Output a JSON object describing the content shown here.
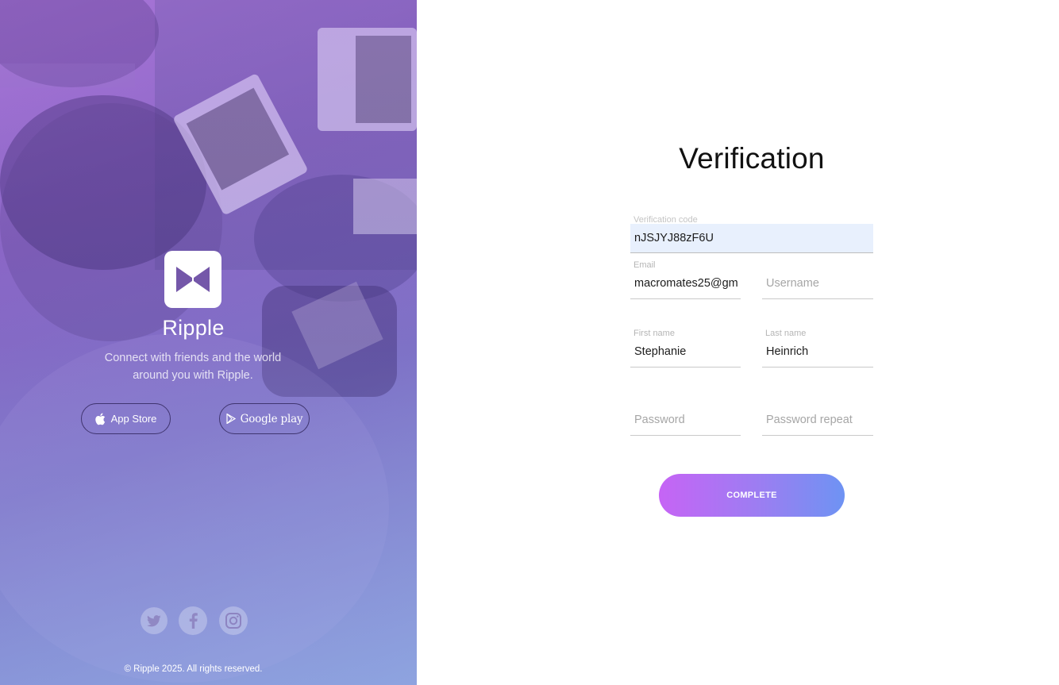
{
  "hero": {
    "brand_name": "Ripple",
    "tagline": "Connect with friends and the world around you with Ripple.",
    "app_store_label": "App Store",
    "google_play_label": "Google play",
    "social_icons": [
      "twitter-icon",
      "facebook-icon",
      "instagram-icon"
    ],
    "copyright": "© Ripple 2025. All rights reserved."
  },
  "form": {
    "title": "Verification",
    "verification_code": {
      "label": "Verification code",
      "value": "nJSJYJ88zF6U"
    },
    "email": {
      "label": "Email",
      "value": "macromates25@gm"
    },
    "username": {
      "placeholder": "Username"
    },
    "first_name": {
      "label": "First name",
      "value": "Stephanie"
    },
    "last_name": {
      "label": "Last name",
      "value": "Heinrich"
    },
    "password": {
      "placeholder": "Password"
    },
    "password_repeat": {
      "placeholder": "Password repeat"
    },
    "submit_label": "COMPLETE"
  },
  "colors": {
    "button_gradient_start": "#c664f5",
    "button_gradient_end": "#6e93f3",
    "hero_purple": "#8a66c4",
    "field_autofill_bg": "#e8f0fd"
  }
}
